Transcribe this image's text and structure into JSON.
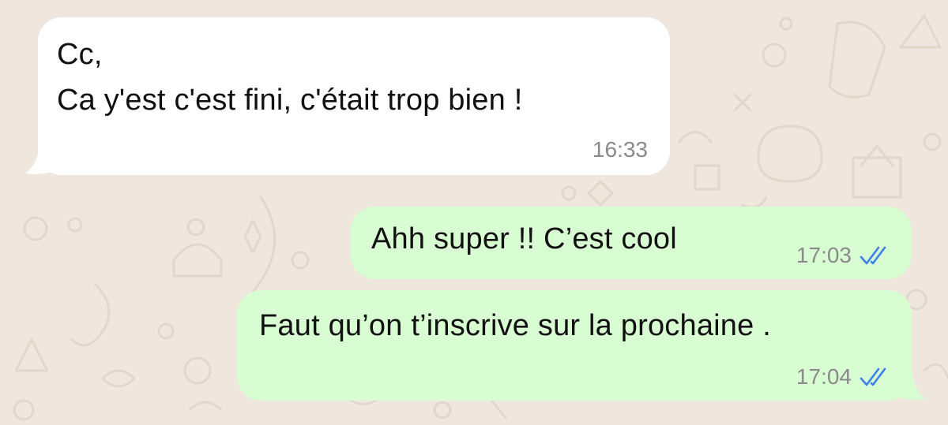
{
  "chat": {
    "messages": [
      {
        "direction": "incoming",
        "lines": [
          "Cc,",
          "Ca y'est c'est fini, c'était trop bien !"
        ],
        "time": "16:33"
      },
      {
        "direction": "outgoing",
        "lines": [
          "Ahh super !! C’est cool"
        ],
        "time": "17:03",
        "status": "read"
      },
      {
        "direction": "outgoing",
        "lines": [
          "Faut qu’on t’inscrive sur la prochaine ."
        ],
        "time": "17:04",
        "status": "read"
      }
    ]
  },
  "colors": {
    "wallpaper": "#efe7de",
    "incoming_bubble": "#ffffff",
    "outgoing_bubble": "#d9fdd3",
    "read_ticks": "#3b82e8",
    "timestamp": "#8a8a8a"
  },
  "icons": {
    "read_receipt": "double-check-icon"
  }
}
